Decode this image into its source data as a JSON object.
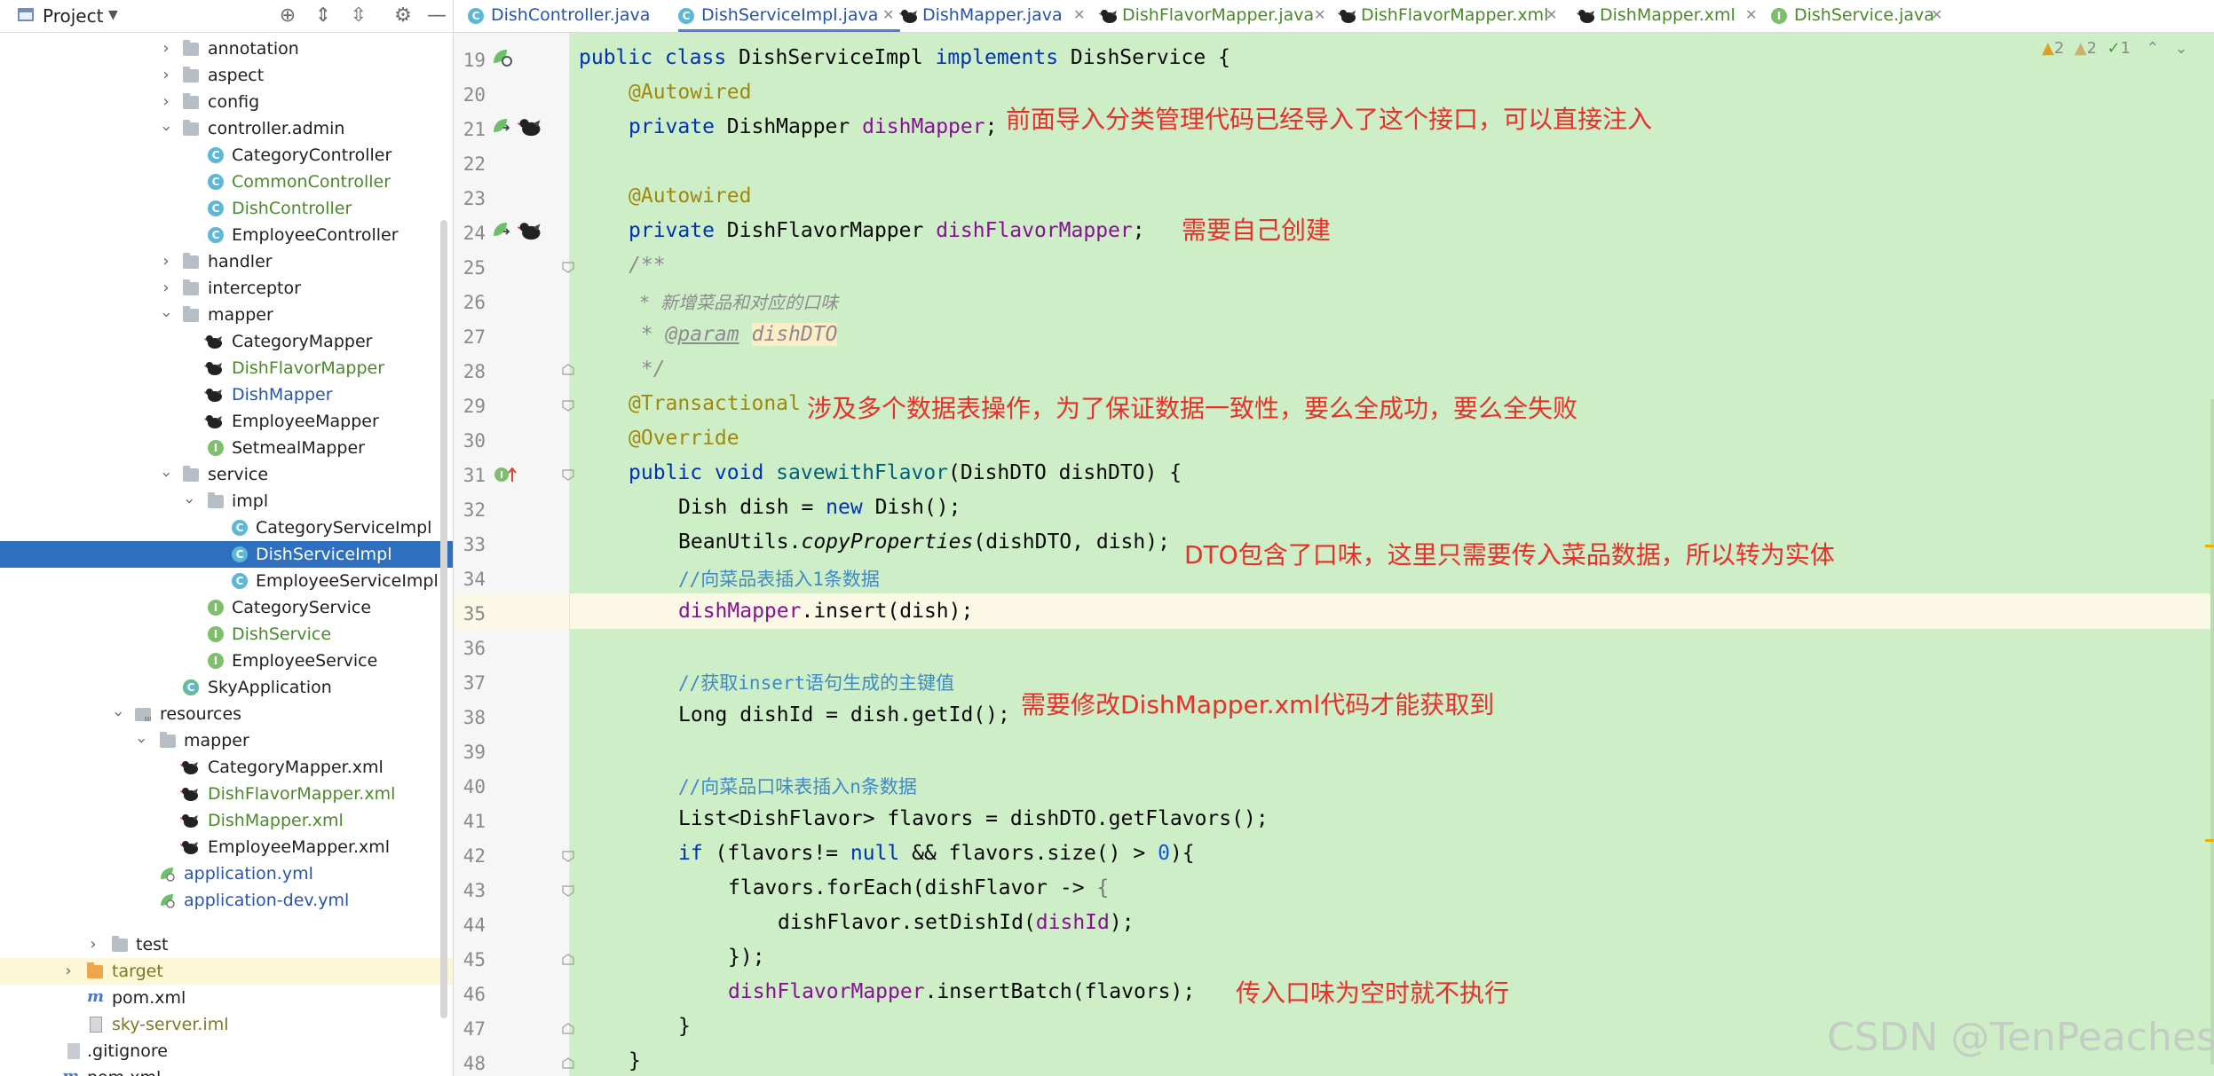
{
  "project_panel": {
    "title": "Project",
    "tree": [
      {
        "label": "annotation",
        "icon": "folder-icon",
        "color": "default"
      },
      {
        "label": "aspect",
        "icon": "folder-icon",
        "color": "default"
      },
      {
        "label": "config",
        "icon": "folder-icon",
        "color": "default"
      },
      {
        "label": "controller.admin",
        "icon": "folder-icon",
        "color": "default"
      },
      {
        "label": "CategoryController",
        "icon": "class-icon",
        "color": "default"
      },
      {
        "label": "CommonController",
        "icon": "class-icon",
        "color": "green"
      },
      {
        "label": "DishController",
        "icon": "class-icon",
        "color": "green"
      },
      {
        "label": "EmployeeController",
        "icon": "class-icon",
        "color": "default"
      },
      {
        "label": "handler",
        "icon": "folder-icon",
        "color": "default"
      },
      {
        "label": "interceptor",
        "icon": "folder-icon",
        "color": "default"
      },
      {
        "label": "mapper",
        "icon": "folder-icon",
        "color": "default"
      },
      {
        "label": "CategoryMapper",
        "icon": "mybatis-icon",
        "color": "default"
      },
      {
        "label": "DishFlavorMapper",
        "icon": "mybatis-icon",
        "color": "green"
      },
      {
        "label": "DishMapper",
        "icon": "mybatis-icon",
        "color": "blue"
      },
      {
        "label": "EmployeeMapper",
        "icon": "mybatis-icon",
        "color": "default"
      },
      {
        "label": "SetmealMapper",
        "icon": "interface-icon",
        "color": "default"
      },
      {
        "label": "service",
        "icon": "folder-icon",
        "color": "default"
      },
      {
        "label": "impl",
        "icon": "folder-icon",
        "color": "default"
      },
      {
        "label": "CategoryServiceImpl",
        "icon": "class-icon",
        "color": "default"
      },
      {
        "label": "DishServiceImpl",
        "icon": "class-icon",
        "color": "white"
      },
      {
        "label": "EmployeeServiceImpl",
        "icon": "class-icon",
        "color": "default"
      },
      {
        "label": "CategoryService",
        "icon": "interface-icon",
        "color": "default"
      },
      {
        "label": "DishService",
        "icon": "interface-icon",
        "color": "green"
      },
      {
        "label": "EmployeeService",
        "icon": "interface-icon",
        "color": "default"
      },
      {
        "label": "SkyApplication",
        "icon": "spring-class-icon",
        "color": "default"
      },
      {
        "label": "resources",
        "icon": "resources-folder-icon",
        "color": "default"
      },
      {
        "label": "mapper",
        "icon": "folder-icon",
        "color": "default"
      },
      {
        "label": "CategoryMapper.xml",
        "icon": "mybatis-icon",
        "color": "default"
      },
      {
        "label": "DishFlavorMapper.xml",
        "icon": "mybatis-icon",
        "color": "green"
      },
      {
        "label": "DishMapper.xml",
        "icon": "mybatis-icon",
        "color": "green"
      },
      {
        "label": "EmployeeMapper.xml",
        "icon": "mybatis-icon",
        "color": "default"
      },
      {
        "label": "application.yml",
        "icon": "spring-leaf-icon",
        "color": "blue"
      },
      {
        "label": "application-dev.yml",
        "icon": "spring-leaf-icon",
        "color": "blue"
      },
      {
        "label": "test",
        "icon": "folder-icon",
        "color": "default"
      },
      {
        "label": "target",
        "icon": "folder-orange-icon",
        "color": "olive"
      },
      {
        "label": "pom.xml",
        "icon": "maven-icon",
        "color": "default"
      },
      {
        "label": "sky-server.iml",
        "icon": "iml-file-icon",
        "color": "olive"
      },
      {
        "label": ".gitignore",
        "icon": "file-icon",
        "color": "default"
      },
      {
        "label": "pom.xml",
        "icon": "maven-icon",
        "color": "default"
      }
    ]
  },
  "tabs": [
    {
      "label": "DishController.java",
      "icon": "class-icon",
      "color": "#2852b2"
    },
    {
      "label": "DishServiceImpl.java",
      "icon": "class-icon",
      "color": "#2852b2"
    },
    {
      "label": "DishMapper.java",
      "icon": "mybatis-icon",
      "color": "#2852b2"
    },
    {
      "label": "DishFlavorMapper.java",
      "icon": "mybatis-icon",
      "color": "#4a8a2a"
    },
    {
      "label": "DishFlavorMapper.xml",
      "icon": "mybatis-icon",
      "color": "#4a8a2a"
    },
    {
      "label": "DishMapper.xml",
      "icon": "mybatis-icon",
      "color": "#4a8a2a"
    },
    {
      "label": "DishService.java",
      "icon": "interface-icon",
      "color": "#4a8a2a"
    }
  ],
  "inspections": {
    "warnings": "2",
    "weak_warnings": "2",
    "typos": "1"
  },
  "editor": {
    "line_numbers": [
      "19",
      "20",
      "21",
      "22",
      "23",
      "24",
      "25",
      "26",
      "27",
      "28",
      "29",
      "30",
      "31",
      "32",
      "33",
      "34",
      "35",
      "36",
      "37",
      "38",
      "39",
      "40",
      "41",
      "42",
      "43",
      "44",
      "45",
      "46",
      "47",
      "48"
    ],
    "code": {
      "l19_a": "public class ",
      "l19_b": "DishServiceImpl ",
      "l19_c": "implements ",
      "l19_d": "DishService {",
      "l20": "@Autowired",
      "l21_a": "private ",
      "l21_b": "DishMapper ",
      "l21_c": "dishMapper",
      "l21_d": ";",
      "l23": "@Autowired",
      "l24_a": "private ",
      "l24_b": "DishFlavorMapper ",
      "l24_c": "dishFlavorMapper",
      "l24_d": ";",
      "l25": "/**",
      "l26": " * 新增菜品和对应的口味",
      "l27_a": " * ",
      "l27_b": "@param",
      "l27_c": " ",
      "l27_d": "dishDTO",
      "l28": " */",
      "l29": "@Transactional",
      "l30": "@Override",
      "l31_a": "public void ",
      "l31_b": "savewithFlavor",
      "l31_c": "(DishDTO dishDTO) {",
      "l32_a": "Dish dish = ",
      "l32_b": "new ",
      "l32_c": "Dish();",
      "l33_a": "BeanUtils.",
      "l33_b": "copyProperties",
      "l33_c": "(dishDTO, dish);",
      "l34": "//向菜品表插入1条数据",
      "l35_a": "dishMapper",
      "l35_b": ".insert(dish);",
      "l37": "//获取insert语句生成的主键值",
      "l38": "Long dishId = dish.getId();",
      "l40": "//向菜品口味表插入n条数据",
      "l41": "List<DishFlavor> flavors = dishDTO.getFlavors();",
      "l42_a": "if ",
      "l42_b": "(flavors!= ",
      "l42_c": "null ",
      "l42_d": "&& flavors.size() > ",
      "l42_e": "0",
      "l42_f": "){",
      "l43_a": "flavors.forEach(dishFlavor -> ",
      "l43_b": "{",
      "l44_a": "dishFlavor.setDishId(",
      "l44_b": "dishId",
      "l44_c": ");",
      "l45": "});",
      "l46_a": "dishFlavorMapper",
      "l46_b": ".insertBatch(flavors);",
      "l47": "}",
      "l48": "}"
    },
    "notes": {
      "n21": "前面导入分类管理代码已经导入了这个接口，可以直接注入",
      "n24": "需要自己创建",
      "n29": "涉及多个数据表操作，为了保证数据一致性，要么全成功，要么全失败",
      "n33": "DTO包含了口味，这里只需要传入菜品数据，所以转为实体",
      "n38": "需要修改DishMapper.xml代码才能获取到",
      "n46": "传入口味为空时就不执行"
    }
  },
  "watermark": "CSDN @TenPeaches",
  "colors": {
    "code_bg": "#cdeec6",
    "selection": "#2f6fc0",
    "note_red": "#e8302a",
    "keyword": "#0033b3",
    "annotation": "#9e880d",
    "field": "#871094"
  }
}
